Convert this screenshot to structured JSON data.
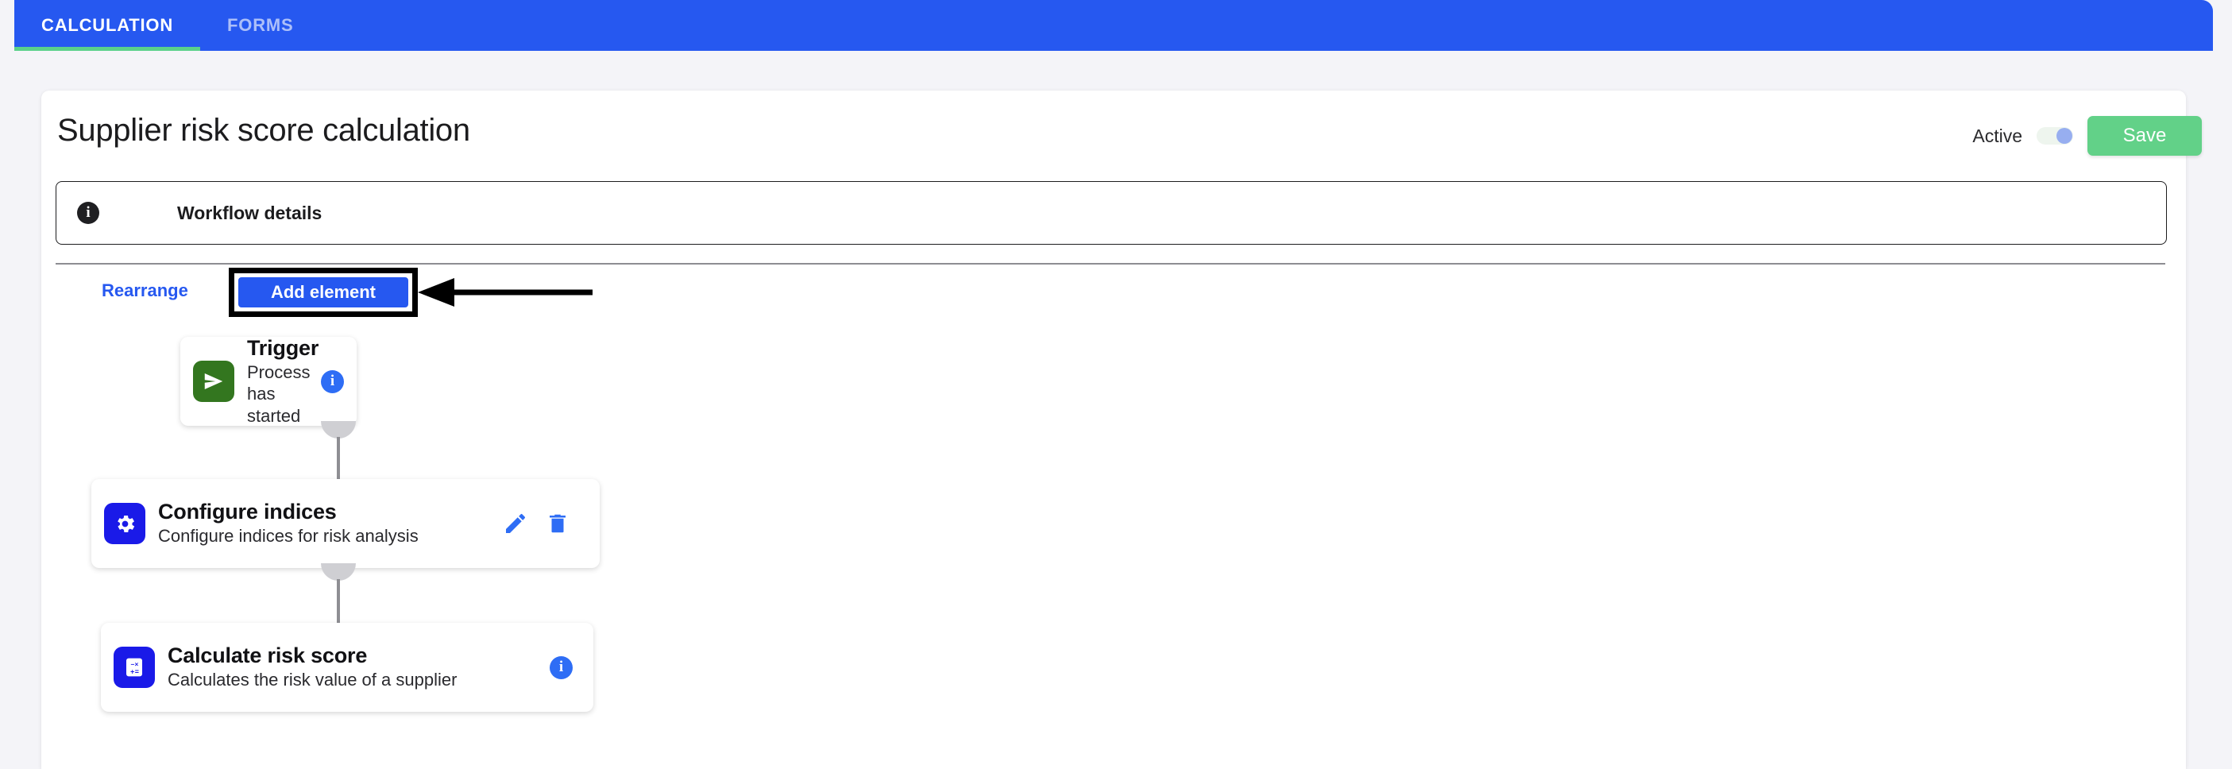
{
  "tabs": [
    {
      "label": "CALCULATION",
      "active": true
    },
    {
      "label": "FORMS",
      "active": false
    }
  ],
  "header": {
    "title": "Supplier risk score calculation",
    "active_label": "Active",
    "active_toggle_state": "on",
    "save_label": "Save"
  },
  "workflow_details": {
    "icon": "info-icon",
    "label": "Workflow details"
  },
  "toolbar": {
    "rearrange_label": "Rearrange",
    "add_element_label": "Add element",
    "annotation": "arrow pointing to Add element button"
  },
  "flow": {
    "nodes": [
      {
        "title": "Trigger",
        "subtitle": "Process has started",
        "icon": "send-arrow-icon",
        "icon_color": "#33761f",
        "actions": [
          "info-icon"
        ]
      },
      {
        "title": "Configure indices",
        "subtitle": "Configure indices for risk analysis",
        "icon": "gear-icon",
        "icon_color": "#1a1ae8",
        "actions": [
          "edit-pencil-icon",
          "delete-trash-icon"
        ]
      },
      {
        "title": "Calculate risk score",
        "subtitle": "Calculates the risk value of a supplier",
        "icon": "calculator-icon",
        "icon_color": "#1a1ae8",
        "actions": [
          "info-icon"
        ]
      }
    ]
  },
  "colors": {
    "brand_blue": "#2658f0",
    "accent_green": "#62d188",
    "tab_underline_green": "#5ad18a",
    "node_icon_blue": "#1a1ae8",
    "node_icon_green": "#33761f",
    "page_background": "#f4f4f8"
  }
}
